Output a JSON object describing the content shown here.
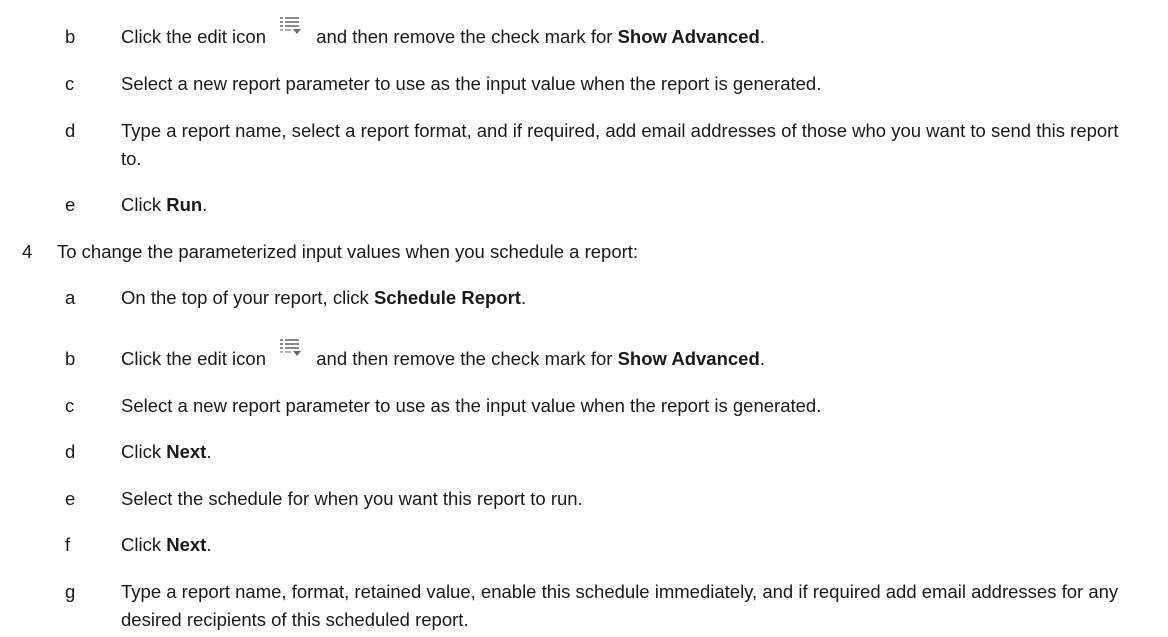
{
  "items": [
    {
      "marker": "b",
      "pre": "Click the edit icon",
      "icon": "edit-list-icon",
      "mid": "and then remove the check mark for",
      "bold": "Show Advanced",
      "post": "."
    },
    {
      "marker": "c",
      "text": "Select a new report parameter to use as the input value when the report is generated."
    },
    {
      "marker": "d",
      "text": "Type a report name, select a report format, and if required, add email addresses of those who you want to send this report to."
    },
    {
      "marker": "e",
      "pre": "Click",
      "bold": "Run",
      "post": "."
    },
    {
      "marker": "4",
      "text": "To change the parameterized input values when you schedule a report:"
    },
    {
      "marker": "a",
      "pre": "On the top of your report, click",
      "bold": "Schedule Report",
      "post": "."
    },
    {
      "marker": "b",
      "pre": "Click the edit icon",
      "icon": "edit-list-icon",
      "mid": "and then remove the check mark for",
      "bold": "Show Advanced",
      "post": "."
    },
    {
      "marker": "c",
      "text": "Select a new report parameter to use as the input value when the report is generated."
    },
    {
      "marker": "d",
      "pre": "Click",
      "bold": "Next",
      "post": "."
    },
    {
      "marker": "e",
      "text": "Select the schedule for when you want this report to run."
    },
    {
      "marker": "f",
      "pre": "Click",
      "bold": "Next",
      "post": "."
    },
    {
      "marker": "g",
      "text": "Type a report name, format, retained value, enable this schedule immediately, and if required add email addresses for any desired recipients of this scheduled report."
    }
  ]
}
